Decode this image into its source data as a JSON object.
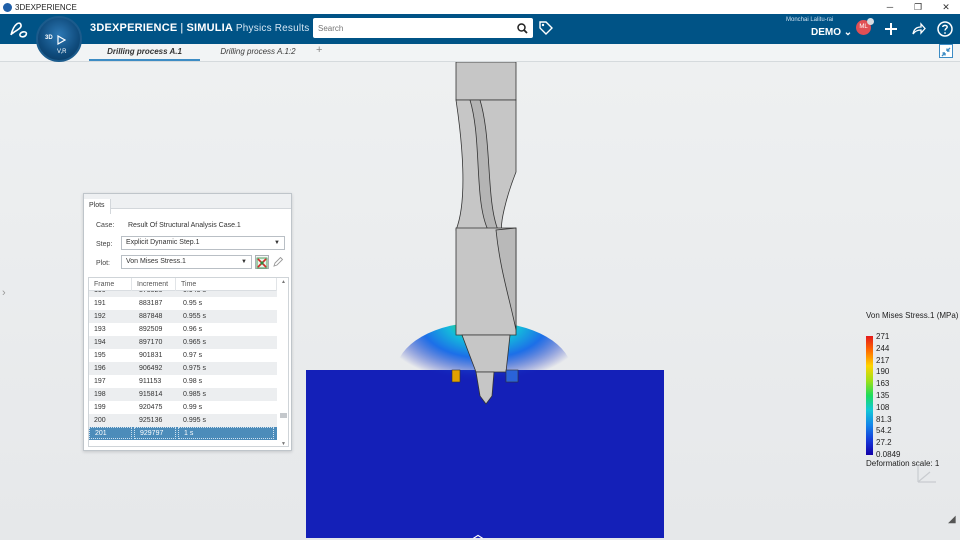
{
  "os_window": {
    "title": "3DEXPERIENCE",
    "minimize": "─",
    "restore": "❐",
    "close": "✕"
  },
  "header": {
    "brand_bold": "3DEXPERIENCE",
    "brand_separator": "|",
    "brand_product": "SIMULIA",
    "brand_app": "Physics Results",
    "search_placeholder": "Search",
    "user_name": "Monchai Lalitu-rai",
    "tenant": "DEMO",
    "avatar_initials": "ML"
  },
  "compass": {
    "label_3d": "3D",
    "version": "V,R"
  },
  "tabs": [
    {
      "label": "Drilling process A.1",
      "active": true
    },
    {
      "label": "Drilling process A.1:2",
      "active": false
    }
  ],
  "tab_add": "+",
  "plots_panel": {
    "tab_label": "Plots",
    "case_label": "Case:",
    "case_value": "Result Of Structural Analysis Case.1",
    "step_label": "Step:",
    "step_value": "Explicit Dynamic Step.1",
    "plot_label": "Plot:",
    "plot_value": "Von Mises Stress.1",
    "columns": [
      "Frame",
      "Increment",
      "Time"
    ],
    "rows": [
      {
        "frame": "190",
        "increment": "878526",
        "time": "0.945 s"
      },
      {
        "frame": "191",
        "increment": "883187",
        "time": "0.95 s"
      },
      {
        "frame": "192",
        "increment": "887848",
        "time": "0.955 s"
      },
      {
        "frame": "193",
        "increment": "892509",
        "time": "0.96 s"
      },
      {
        "frame": "194",
        "increment": "897170",
        "time": "0.965 s"
      },
      {
        "frame": "195",
        "increment": "901831",
        "time": "0.97 s"
      },
      {
        "frame": "196",
        "increment": "906492",
        "time": "0.975 s"
      },
      {
        "frame": "197",
        "increment": "911153",
        "time": "0.98 s"
      },
      {
        "frame": "198",
        "increment": "915814",
        "time": "0.985 s"
      },
      {
        "frame": "199",
        "increment": "920475",
        "time": "0.99 s"
      },
      {
        "frame": "200",
        "increment": "925136",
        "time": "0.995 s"
      },
      {
        "frame": "201",
        "increment": "929797",
        "time": "1 s"
      }
    ],
    "selected_frame": "201"
  },
  "legend": {
    "title": "Von Mises Stress.1 (MPa)",
    "values": [
      "271",
      "244",
      "217",
      "190",
      "163",
      "135",
      "108",
      "81.3",
      "54.2",
      "27.2",
      "0.0849"
    ],
    "deformation_scale": "Deformation scale: 1",
    "colors": [
      "#e41a1c",
      "#ff6a00",
      "#ffd400",
      "#9be01a",
      "#1ddc5c",
      "#12c9d6",
      "#1384ea",
      "#1537d8",
      "#1400a8"
    ]
  },
  "colors": {
    "header_bg": "#005386",
    "accent": "#3d8cc4",
    "workpiece_blue": "#1420b8",
    "drill_gray": "#c6c6c6"
  }
}
